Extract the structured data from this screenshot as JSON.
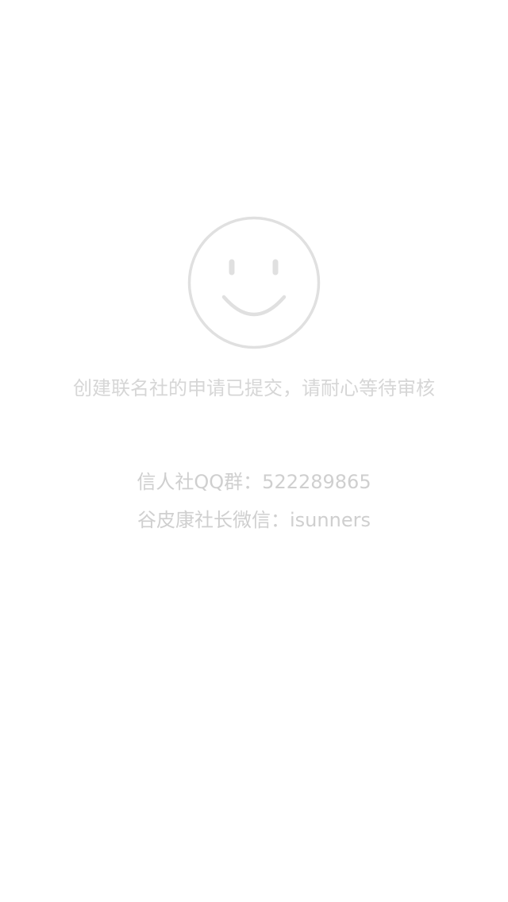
{
  "icon": "smiley-face-icon",
  "colors": {
    "background": "#ffffff",
    "icon_stroke": "#e0e0e0",
    "text": "#d3d3d3"
  },
  "status": {
    "message": "创建联名社的申请已提交，请耐心等待审核"
  },
  "contacts": {
    "qq_group": "信人社QQ群：522289865",
    "wechat": "谷皮康社长微信：isunners"
  }
}
